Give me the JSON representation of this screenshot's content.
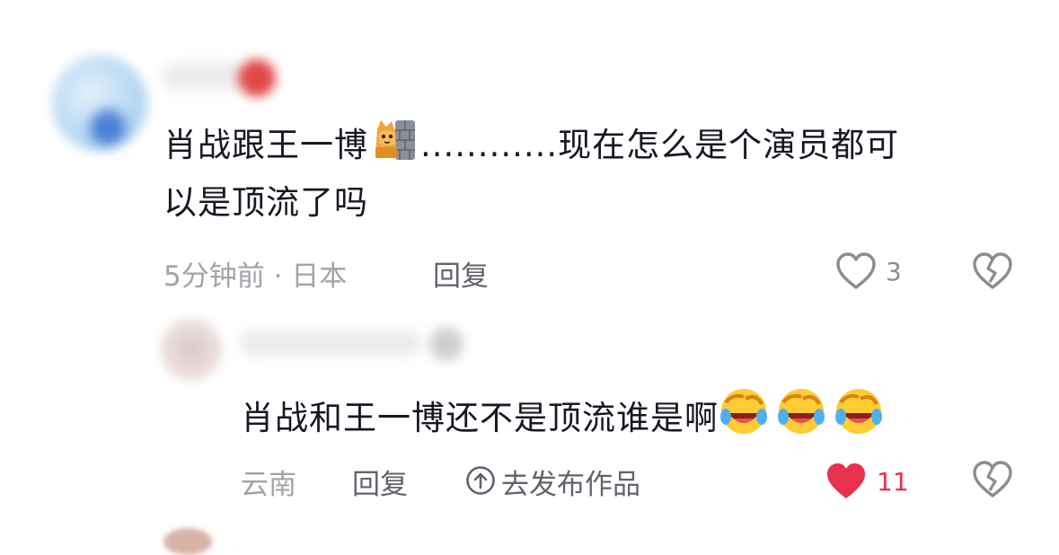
{
  "comment": {
    "text_part1": "肖战跟王一博",
    "text_dots": "............",
    "text_part2": "现在怎么是个演员都可",
    "text_line2": "以是顶流了吗",
    "meta": "5分钟前 · 日本",
    "reply_label": "回复",
    "like_count": "3",
    "emoji": "cat-wall-emoji"
  },
  "reply": {
    "text": "肖战和王一博还不是顶流谁是啊",
    "emoji": "laughing-crying-emoji",
    "location": "云南",
    "reply_label": "回复",
    "publish_label": "去发布作品",
    "like_count": "11",
    "liked_color": "#e8304f"
  }
}
